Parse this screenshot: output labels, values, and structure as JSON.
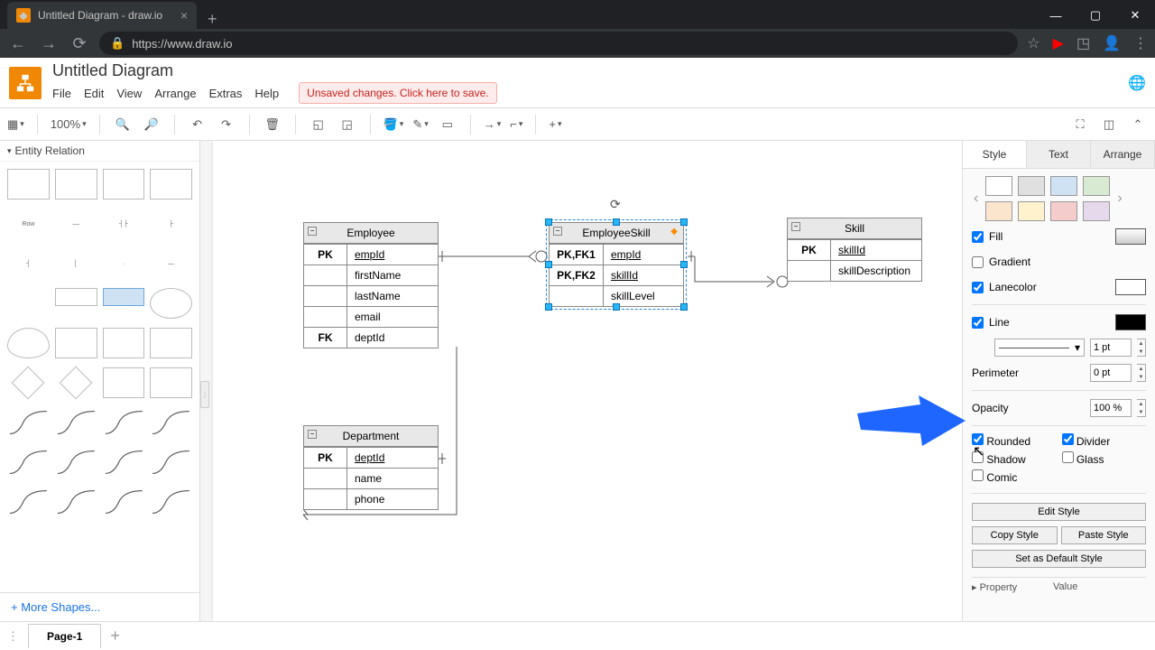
{
  "browser": {
    "tab_title": "Untitled Diagram - draw.io",
    "url": "https://www.draw.io"
  },
  "header": {
    "doc_title": "Untitled Diagram",
    "menu": [
      "File",
      "Edit",
      "View",
      "Arrange",
      "Extras",
      "Help"
    ],
    "unsaved": "Unsaved changes. Click here to save."
  },
  "toolbar": {
    "zoom": "100%"
  },
  "sidebar": {
    "palette_title": "Entity Relation",
    "row_label": "Row",
    "more_shapes": "+ More Shapes..."
  },
  "canvas": {
    "entities": {
      "employee": {
        "title": "Employee",
        "rows": [
          {
            "key": "PK",
            "val": "empId",
            "u": true
          },
          {
            "key": "",
            "val": "firstName"
          },
          {
            "key": "",
            "val": "lastName"
          },
          {
            "key": "",
            "val": "email"
          },
          {
            "key": "FK",
            "val": "deptId"
          }
        ]
      },
      "employee_skill": {
        "title": "EmployeeSkill",
        "rows": [
          {
            "key": "PK,FK1",
            "val": "empId",
            "u": true
          },
          {
            "key": "PK,FK2",
            "val": "skillId",
            "u": true
          },
          {
            "key": "",
            "val": "skillLevel"
          }
        ]
      },
      "skill": {
        "title": "Skill",
        "rows": [
          {
            "key": "PK",
            "val": "skillId",
            "u": true
          },
          {
            "key": "",
            "val": "skillDescription"
          }
        ]
      },
      "department": {
        "title": "Department",
        "rows": [
          {
            "key": "PK",
            "val": "deptId",
            "u": true
          },
          {
            "key": "",
            "val": "name"
          },
          {
            "key": "",
            "val": "phone"
          }
        ]
      }
    }
  },
  "format": {
    "tabs": [
      "Style",
      "Text",
      "Arrange"
    ],
    "fill": "Fill",
    "gradient": "Gradient",
    "lanecolor": "Lanecolor",
    "line": "Line",
    "line_weight": "1 pt",
    "perimeter": "Perimeter",
    "perimeter_val": "0 pt",
    "opacity": "Opacity",
    "opacity_val": "100 %",
    "rounded": "Rounded",
    "divider": "Divider",
    "shadow": "Shadow",
    "glass": "Glass",
    "comic": "Comic",
    "edit_style": "Edit Style",
    "copy_style": "Copy Style",
    "paste_style": "Paste Style",
    "default_style": "Set as Default Style",
    "property": "Property",
    "value": "Value"
  },
  "footer": {
    "page": "Page-1"
  }
}
